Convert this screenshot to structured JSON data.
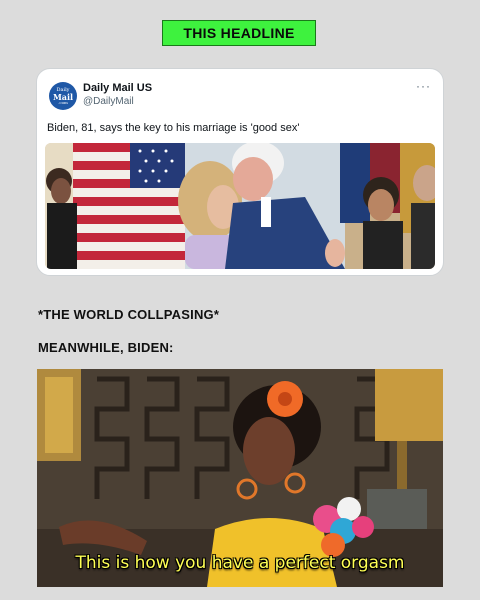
{
  "headline": "THIS HEADLINE",
  "tweet": {
    "avatar": {
      "line1": "Daily",
      "line2": "Mail",
      "line3": ".com"
    },
    "name": "Daily Mail US",
    "handle": "@DailyMail",
    "more": "···",
    "text": "Biden, 81, says the key to his marriage is 'good sex'"
  },
  "section1": "*THE WORLD COLLPASING*",
  "section2": "MEANWHILE, BIDEN:",
  "meme": {
    "caption": "This is how you have a perfect orgasm"
  },
  "colors": {
    "headline_bg": "#3ef23e",
    "caption": "#ffff55",
    "page_bg": "#dcdcdc"
  }
}
